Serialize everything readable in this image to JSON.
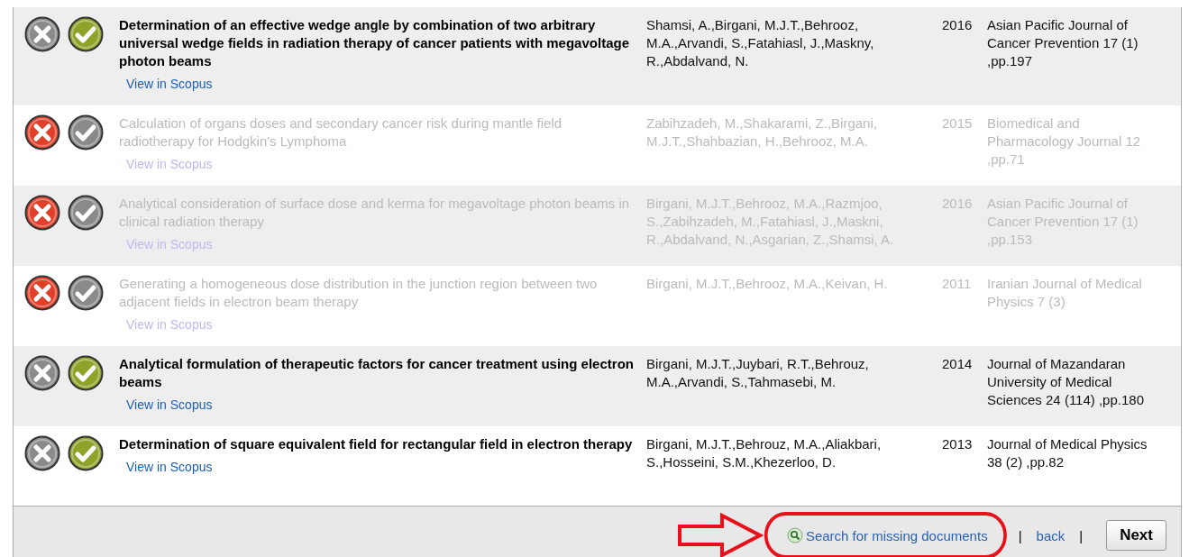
{
  "documents": [
    {
      "included": true,
      "title": "Determination of an effective wedge angle by combination of two arbitrary universal wedge fields in radiation therapy of cancer patients with megavoltage photon beams",
      "link": "View in Scopus",
      "authors": "Shamsi, A.,Birgani, M.J.T.,Behrooz, M.A.,Arvandi, S.,Fatahiasl, J.,Maskny, R.,Abdalvand, N.",
      "year": "2016",
      "source": "Asian Pacific Journal of Cancer Prevention 17 (1) ,pp.197"
    },
    {
      "included": false,
      "title": "Calculation of organs doses and secondary cancer risk during mantle field radiotherapy for Hodgkin's Lymphoma",
      "link": "View in Scopus",
      "authors": "Zabihzadeh, M.,Shakarami, Z.,Birgani, M.J.T.,Shahbazian, H.,Behrooz, M.A.",
      "year": "2015",
      "source": "Biomedical and Pharmacology Journal 12 ,pp.71"
    },
    {
      "included": false,
      "title": "Analytical consideration of surface dose and kerma for megavoltage photon beams in clinical radiation therapy",
      "link": "View in Scopus",
      "authors": "Birgani, M.J.T.,Behrooz, M.A.,Razmjoo, S.,Zabihzadeh, M.,Fatahiasl, J.,Maskni, R.,Abdalvand, N.,Asgarian, Z.,Shamsi, A.",
      "year": "2016",
      "source": "Asian Pacific Journal of Cancer Prevention 17 (1) ,pp.153"
    },
    {
      "included": false,
      "title": "Generating a homogeneous dose distribution in the junction region between two adjacent fields in electron beam therapy",
      "link": "View in Scopus",
      "authors": "Birgani, M.J.T.,Behrooz, M.A.,Keivan, H.",
      "year": "2011",
      "source": "Iranian Journal of Medical Physics 7 (3)"
    },
    {
      "included": true,
      "title": "Analytical formulation of therapeutic factors for cancer treatment using electron beams",
      "link": "View in Scopus",
      "authors": "Birgani, M.J.T.,Juybari, R.T.,Behrouz, M.A.,Arvandi, S.,Tahmasebi, M.",
      "year": "2014",
      "source": "Journal of Mazandaran University of Medical Sciences 24 (114) ,pp.180"
    },
    {
      "included": true,
      "title": "Determination of square equivalent field for rectangular field in electron therapy",
      "link": "View in Scopus",
      "authors": "Birgani, M.J.T.,Behrouz, M.A.,Aliakbari, S.,Hosseini, S.M.,Khezerloo, D.",
      "year": "2013",
      "source": "Journal of Medical Physics 38 (2) ,pp.82"
    }
  ],
  "footer": {
    "search_link": "Search for missing documents",
    "separator_1": "|",
    "back_link": "back",
    "separator_2": "|",
    "next_button": "Next"
  }
}
